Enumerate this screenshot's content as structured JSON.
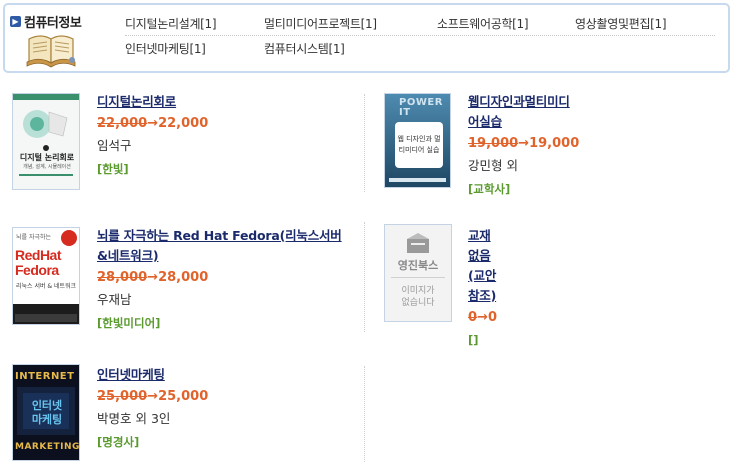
{
  "category": {
    "title": "컴퓨터정보",
    "links_row1": [
      {
        "label": "디지털논리설계[1]"
      },
      {
        "label": "멀티미디어프로젝트[1]"
      },
      {
        "label": "소프트웨어공학[1]"
      },
      {
        "label": "영상촬영및편집[1]"
      }
    ],
    "links_row2": [
      {
        "label": "인터넷마케팅[1]"
      },
      {
        "label": "컴퓨터시스템[1]"
      }
    ]
  },
  "books": [
    {
      "title": "디지털논리회로",
      "old_price": "22,000",
      "arrow": "→",
      "new_price": "22,000",
      "author": "임석구",
      "publisher": "[한빛]",
      "cover_title": "디지털 논리회로",
      "cover_sub": "개념, 설계, 시뮬레이션"
    },
    {
      "title": "웹디자인과멀티미디어실습",
      "old_price": "19,000",
      "arrow": "→",
      "new_price": "19,000",
      "author": "강민형 외",
      "publisher": "[교학사]",
      "cover_top": "POWER IT",
      "cover_title": "웹 디자인과 멀티미디어 실습"
    },
    {
      "title": "뇌를 자극하는 Red Hat Fedora(리눅스서버&네트워크)",
      "old_price": "28,000",
      "arrow": "→",
      "new_price": "28,000",
      "author": "우재남",
      "publisher": "[한빛미디어]",
      "cover_top": "뇌를 자극하는",
      "cover_title": "RedHat Fedora",
      "cover_sub": "리눅스 서버 & 네트워크"
    },
    {
      "title": "교재없음(교안참조)",
      "old_price": "0",
      "arrow": "→",
      "new_price": "0",
      "author": "",
      "publisher": "[]",
      "cover_logo": "영진북스",
      "cover_msg1": "이미지가",
      "cover_msg2": "없습니다"
    },
    {
      "title": "인터넷마케팅",
      "old_price": "25,000",
      "arrow": "→",
      "new_price": "25,000",
      "author": "박명호 외 3인",
      "publisher": "[명경사]",
      "cover_top": "INTERNET",
      "cover_title": "인터넷 마케팅",
      "cover_bottom": "MARKETING"
    }
  ],
  "colors": {
    "title": "#1b2a6b",
    "price": "#e0632b",
    "publisher": "#5a9a2f",
    "border": "#c7d9ec"
  }
}
